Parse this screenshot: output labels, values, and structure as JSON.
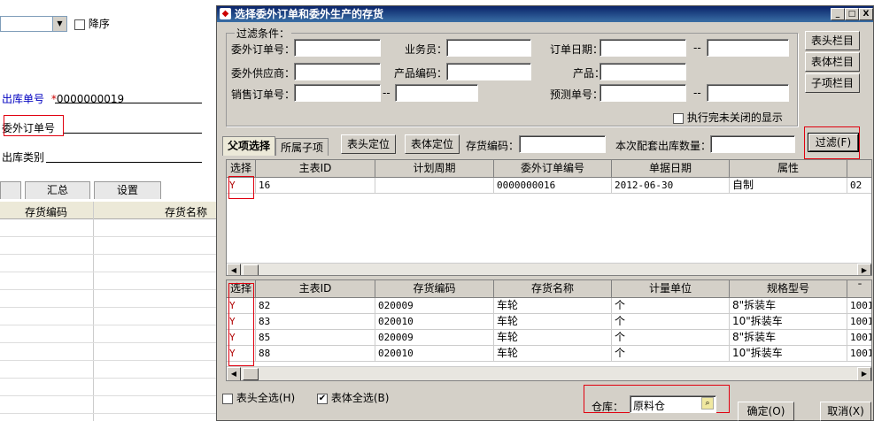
{
  "left": {
    "sort_label": "降序",
    "fields": [
      {
        "label": "出库单号",
        "star": "*",
        "value": "0000000019"
      },
      {
        "label": "委外订单号",
        "value": ""
      },
      {
        "label": "出库类别",
        "value": ""
      }
    ],
    "tabs": [
      "",
      "汇总",
      "设置"
    ],
    "columns": [
      "存货编码",
      "存货名称"
    ]
  },
  "dialog": {
    "title": "选择委外订单和委外生产的存货",
    "window_buttons": [
      "_",
      "□",
      "X"
    ],
    "filter_group_title": "过滤条件：",
    "filters": {
      "order_no": "委外订单号：",
      "salesman": "业务员：",
      "order_date": "订单日期：",
      "supplier": "委外供应商：",
      "product_code": "产品编码：",
      "product": "产品：",
      "sales_order_no": "销售订单号：",
      "forecast_no": "预测单号：",
      "range_sep": "--",
      "closed_label": "执行完未关闭的显示"
    },
    "side_buttons": [
      "表头栏目",
      "表体栏目",
      "子项栏目"
    ],
    "tabs": [
      "父项选择",
      "所属子项"
    ],
    "toolbar": {
      "head_locate": "表头定位",
      "body_locate": "表体定位",
      "inv_code_label": "存货编码：",
      "qty_label": "本次配套出库数量：",
      "filter_btn": "过滤(F)"
    },
    "top_grid": {
      "columns": [
        "选择",
        "主表ID",
        "计划周期",
        "委外订单编号",
        "单据日期",
        "属性",
        ""
      ],
      "rows": [
        [
          "Y",
          "16",
          "",
          "0000000016",
          "2012-06-30",
          "自制",
          "02"
        ]
      ]
    },
    "bottom_grid": {
      "columns": [
        "选择",
        "主表ID",
        "存货编码",
        "存货名称",
        "计量单位",
        "规格型号",
        "¯"
      ],
      "rows": [
        [
          "Y",
          "82",
          "020009",
          "车轮",
          "个",
          "8\"拆装车",
          "1001"
        ],
        [
          "Y",
          "83",
          "020010",
          "车轮",
          "个",
          "10\"拆装车",
          "1001"
        ],
        [
          "Y",
          "85",
          "020009",
          "车轮",
          "个",
          "8\"拆装车",
          "1001"
        ],
        [
          "Y",
          "88",
          "020010",
          "车轮",
          "个",
          "10\"拆装车",
          "1001"
        ]
      ]
    },
    "footer": {
      "head_all": "表头全选(H)",
      "body_all": "表体全选(B)",
      "warehouse_label": "仓库：",
      "warehouse_value": "原料仓",
      "ok": "确定(O)",
      "cancel": "取消(X)"
    }
  }
}
